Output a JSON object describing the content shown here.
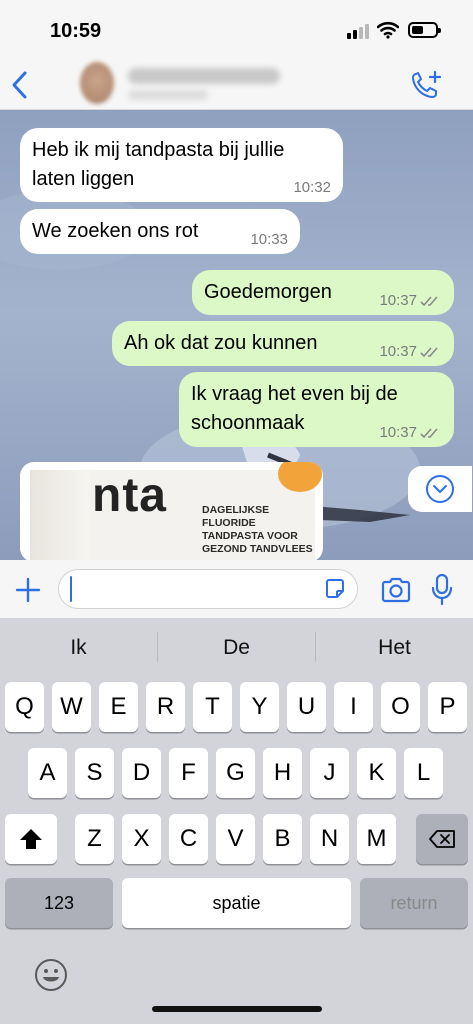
{
  "status_bar": {
    "time": "10:59",
    "icons": [
      "signal-icon",
      "wifi-icon",
      "battery-icon"
    ]
  },
  "header": {
    "icons": [
      "back-chevron-icon",
      "avatar",
      "add-call-icon"
    ]
  },
  "messages": [
    {
      "direction": "incoming",
      "lines": [
        "Heb ik mij tandpasta bij jullie",
        "laten liggen"
      ],
      "time": "10:32"
    },
    {
      "direction": "incoming",
      "lines": [
        "We zoeken ons rot"
      ],
      "time": "10:33"
    },
    {
      "direction": "outgoing",
      "lines": [
        "Goedemorgen"
      ],
      "time": "10:37",
      "status": "read"
    },
    {
      "direction": "outgoing",
      "lines": [
        "Ah ok dat zou kunnen"
      ],
      "time": "10:37",
      "status": "read"
    },
    {
      "direction": "outgoing",
      "lines": [
        "Ik vraag het even bij de",
        "schoonmaak"
      ],
      "time": "10:37",
      "status": "read"
    }
  ],
  "image_message": {
    "brand_text": "nta",
    "label_lines": [
      "DAGELIJKSE",
      "FLUORIDE",
      "TANDPASTA VOOR",
      "GEZOND TANDVLEES"
    ]
  },
  "input_bar": {
    "value": "",
    "icons": [
      "plus-icon",
      "sticker-icon",
      "camera-icon",
      "microphone-icon"
    ]
  },
  "keyboard": {
    "suggestions": [
      "Ik",
      "De",
      "Het"
    ],
    "row1": [
      "Q",
      "W",
      "E",
      "R",
      "T",
      "Y",
      "U",
      "I",
      "O",
      "P"
    ],
    "row2": [
      "A",
      "S",
      "D",
      "F",
      "G",
      "H",
      "J",
      "K",
      "L"
    ],
    "row3": [
      "Z",
      "X",
      "C",
      "V",
      "B",
      "N",
      "M"
    ],
    "numbers_label": "123",
    "space_label": "spatie",
    "return_label": "return"
  },
  "colors": {
    "outgoing_bubble": "#dcf8c6",
    "incoming_bubble": "#ffffff",
    "accent": "#2f6fe6",
    "wallpaper": "#9aabc7"
  }
}
